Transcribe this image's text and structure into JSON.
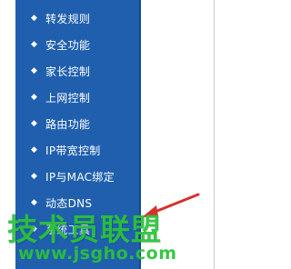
{
  "sidebar": {
    "bullet_glyph": "◆",
    "items": [
      {
        "label": "转发规则"
      },
      {
        "label": "安全功能"
      },
      {
        "label": "家长控制"
      },
      {
        "label": "上网控制"
      },
      {
        "label": "路由功能"
      },
      {
        "label": "IP带宽控制"
      },
      {
        "label": "IP与MAC绑定"
      },
      {
        "label": "动态DNS"
      },
      {
        "label": "系统工具"
      }
    ]
  },
  "watermark": {
    "title": "技术员联盟",
    "url": "www.jsgho.com"
  },
  "colors": {
    "sidebar_bg": "#1f5fae",
    "menu_text": "#ffffff",
    "watermark": "#2cc23a",
    "arrow": "#d9302c"
  }
}
